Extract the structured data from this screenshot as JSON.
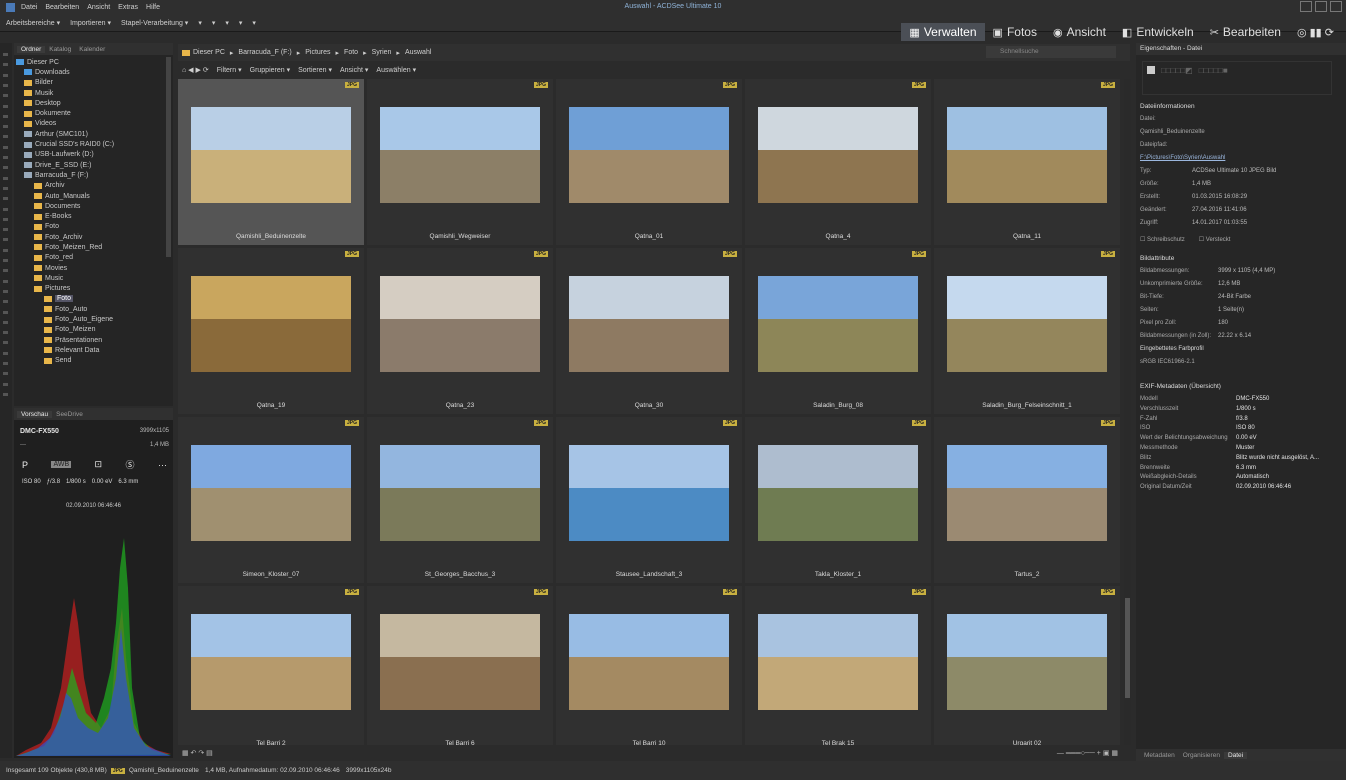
{
  "window": {
    "title": "Auswahl - ACDSee Ultimate 10"
  },
  "menu": [
    "Datei",
    "Bearbeiten",
    "Ansicht",
    "Extras",
    "Hilfe"
  ],
  "toolbar": [
    "Arbeitsbereiche ▾",
    "Importieren ▾",
    "Stapel-Verarbeitung ▾",
    "▾",
    "▾",
    "▾",
    "▾",
    "▾"
  ],
  "modes": [
    {
      "label": "Verwalten",
      "icon": "grid-icon"
    },
    {
      "label": "Fotos",
      "icon": "photos-icon"
    },
    {
      "label": "Ansicht",
      "icon": "eye-icon"
    },
    {
      "label": "Entwickeln",
      "icon": "develop-icon"
    },
    {
      "label": "Bearbeiten",
      "icon": "edit-icon"
    }
  ],
  "left_panel": {
    "tabs": [
      "Ordner",
      "Katalog",
      "Kalender"
    ],
    "folders": [
      {
        "label": "Dieser PC",
        "kind": "pc"
      },
      {
        "label": "Downloads",
        "kind": "dl"
      },
      {
        "label": "Bilder",
        "kind": "folder"
      },
      {
        "label": "Musik",
        "kind": "folder"
      },
      {
        "label": "Desktop",
        "kind": "folder"
      },
      {
        "label": "Dokumente",
        "kind": "folder"
      },
      {
        "label": "Videos",
        "kind": "folder"
      },
      {
        "label": "Arthur (SMC101)",
        "kind": "drive"
      },
      {
        "label": "Crucial SSD's RAID0 (C:)",
        "kind": "drive"
      },
      {
        "label": "USB-Laufwerk (D:)",
        "kind": "drive"
      },
      {
        "label": "Drive_E_SSD (E:)",
        "kind": "drive"
      },
      {
        "label": "Barracuda_F (F:)",
        "kind": "drive"
      },
      {
        "label": "Archiv",
        "kind": "folder"
      },
      {
        "label": "Auto_Manuals",
        "kind": "folder"
      },
      {
        "label": "Documents",
        "kind": "folder"
      },
      {
        "label": "E-Books",
        "kind": "folder"
      },
      {
        "label": "Foto",
        "kind": "folder"
      },
      {
        "label": "Foto_Archiv",
        "kind": "folder"
      },
      {
        "label": "Foto_Meizen_Red",
        "kind": "folder"
      },
      {
        "label": "Foto_red",
        "kind": "folder"
      },
      {
        "label": "Movies",
        "kind": "folder"
      },
      {
        "label": "Music",
        "kind": "folder"
      },
      {
        "label": "Pictures",
        "kind": "folder"
      },
      {
        "label": "Foto",
        "kind": "folder",
        "selected": true
      },
      {
        "label": "Foto_Auto",
        "kind": "folder"
      },
      {
        "label": "Foto_Auto_Eigene",
        "kind": "folder"
      },
      {
        "label": "Foto_Meizen",
        "kind": "folder"
      },
      {
        "label": "Präsentationen",
        "kind": "folder"
      },
      {
        "label": "Relevant Data",
        "kind": "folder"
      },
      {
        "label": "Send",
        "kind": "folder"
      }
    ]
  },
  "preview": {
    "tabs": [
      "Vorschau",
      "SeeDrive"
    ],
    "model": "DMC-FX550",
    "resolution": "3999x1105",
    "filesize": "1,4 MB",
    "dash": "---",
    "mode": "P",
    "exif": {
      "iso": "ISO 80",
      "aperture": "ƒ/3.8",
      "shutter": "1/800 s",
      "ev": "0.00 eV",
      "focal": "6.3 mm"
    },
    "date": "02.09.2010 06:46:46"
  },
  "breadcrumb": [
    "Dieser PC",
    "Barracuda_F (F:)",
    "Pictures",
    "Foto",
    "Syrien",
    "Auswahl"
  ],
  "search_placeholder": "Schnellsuche",
  "filterbar": [
    "Filtern ▾",
    "Gruppieren ▾",
    "Sortieren ▾",
    "Ansicht ▾",
    "Auswählen ▾"
  ],
  "badge": "JPG",
  "thumbnails": [
    {
      "name": "Qamishli_Beduinenzelte",
      "selected": true,
      "sky": "#b9cfe6",
      "ground": "#c9b07a"
    },
    {
      "name": "Qamishli_Wegweiser",
      "sky": "#a9c8e8",
      "ground": "#8c7f67"
    },
    {
      "name": "Qatna_01",
      "sky": "#6f9fd6",
      "ground": "#a08a6a"
    },
    {
      "name": "Qatna_4",
      "sky": "#cfd7de",
      "ground": "#8e7550"
    },
    {
      "name": "Qatna_11",
      "sky": "#9ec0e2",
      "ground": "#a18a5c"
    },
    {
      "name": "Qatna_19",
      "sky": "#c9a65e",
      "ground": "#8a6a3a"
    },
    {
      "name": "Qatna_23",
      "sky": "#d5cdc2",
      "ground": "#8b7b6b"
    },
    {
      "name": "Qatna_30",
      "sky": "#c6d2de",
      "ground": "#8e7a62"
    },
    {
      "name": "Saladin_Burg_08",
      "sky": "#79a5d9",
      "ground": "#8d8658"
    },
    {
      "name": "Saladin_Burg_Felseinschnitt_1",
      "sky": "#c5d9ee",
      "ground": "#94865c"
    },
    {
      "name": "Simeon_Kloster_07",
      "sky": "#7fa9e0",
      "ground": "#a09070"
    },
    {
      "name": "St_Georges_Bacchus_3",
      "sky": "#93b6df",
      "ground": "#7b7a5a"
    },
    {
      "name": "Stausee_Landschaft_3",
      "sky": "#a6c4e6",
      "ground": "#4c8bc4"
    },
    {
      "name": "Takla_Kloster_1",
      "sky": "#aebdcf",
      "ground": "#6f7c52"
    },
    {
      "name": "Tartus_2",
      "sky": "#86b0e2",
      "ground": "#9b8a72"
    },
    {
      "name": "Tel Barri 2",
      "sky": "#a3c3e6",
      "ground": "#b69a6c"
    },
    {
      "name": "Tel Barri 6",
      "sky": "#c5b8a0",
      "ground": "#8a6f50"
    },
    {
      "name": "Tel Barri 10",
      "sky": "#98bce4",
      "ground": "#a48a62"
    },
    {
      "name": "Tel Brak 15",
      "sky": "#a9c3e0",
      "ground": "#c2a878"
    },
    {
      "name": "Urgarit 02",
      "sky": "#a1c2e4",
      "ground": "#8d8a68"
    }
  ],
  "properties": {
    "title": "Eigenschaften - Datei",
    "file_section": "Dateiinformationen",
    "file_rows": [
      {
        "k": "Datei:",
        "v": ""
      },
      {
        "k": "Qamishli_Beduinenzelte",
        "v": ""
      },
      {
        "k": "Dateipfad:",
        "v": ""
      },
      {
        "k": "F:\\Pictures\\Foto\\Syrien\\Auswahl",
        "v": ""
      },
      {
        "k": "Typ:",
        "v": "ACDSee Ultimate 10 JPEG Bild"
      },
      {
        "k": "Größe:",
        "v": "1,4 MB"
      },
      {
        "k": "Erstellt:",
        "v": "01.03.2015 16:08:29"
      },
      {
        "k": "Geändert:",
        "v": "27.04.2016 11:41:06"
      },
      {
        "k": "Zugriff:",
        "v": "14.01.2017 01:03:55"
      }
    ],
    "flags": [
      "Schreibschutz",
      "Versteckt"
    ],
    "image_section": "Bildattribute",
    "image_rows": [
      {
        "k": "Bildabmessungen:",
        "v": "3999 x 1105 (4,4 MP)"
      },
      {
        "k": "Unkomprimierte Größe:",
        "v": "12,6 MB"
      },
      {
        "k": "Bit-Tiefe:",
        "v": "24-Bit Farbe"
      },
      {
        "k": "Seiten:",
        "v": "1 Seite(n)"
      },
      {
        "k": "Pixel pro Zoll:",
        "v": "180"
      },
      {
        "k": "Bildabmessungen (in Zoll):",
        "v": "22.22 x 6.14"
      },
      {
        "k": "Eingebettetes Farbprofil",
        "v": ""
      },
      {
        "k": "sRGB IEC61966-2.1",
        "v": ""
      }
    ],
    "exif_section": "EXIF-Metadaten (Übersicht)",
    "exif_rows": [
      {
        "k": "Modell",
        "v": "DMC-FX550"
      },
      {
        "k": "Verschlusszeit",
        "v": "1/800 s"
      },
      {
        "k": "F-Zahl",
        "v": "f/3.8"
      },
      {
        "k": "ISO",
        "v": "ISO 80"
      },
      {
        "k": "Wert der Belichtungsabweichung",
        "v": "0.00 eV"
      },
      {
        "k": "Messmethode",
        "v": "Muster"
      },
      {
        "k": "Blitz",
        "v": "Blitz wurde nicht ausgelöst, A..."
      },
      {
        "k": "Brennweite",
        "v": "6.3 mm"
      },
      {
        "k": "Weißabgleich-Details",
        "v": "Automatisch"
      },
      {
        "k": "Original Datum/Zeit",
        "v": "02.09.2010 06:46:46"
      }
    ],
    "tabs": [
      "Metadaten",
      "Organisieren",
      "Datei"
    ]
  },
  "status": {
    "total": "Insgesamt 109 Objekte (430,8 MB)",
    "badge": "JPG",
    "file": "Qamishli_Beduinenzelte",
    "info": "1,4 MB, Aufnahmedatum: 02.09.2010 06:46:46",
    "dims": "3999x1105x24b"
  },
  "colors": {
    "accent": "#4b4f56",
    "badge": "#c8b040",
    "histo_red": "#c02020",
    "histo_green": "#20b020",
    "histo_blue": "#3050d0"
  }
}
